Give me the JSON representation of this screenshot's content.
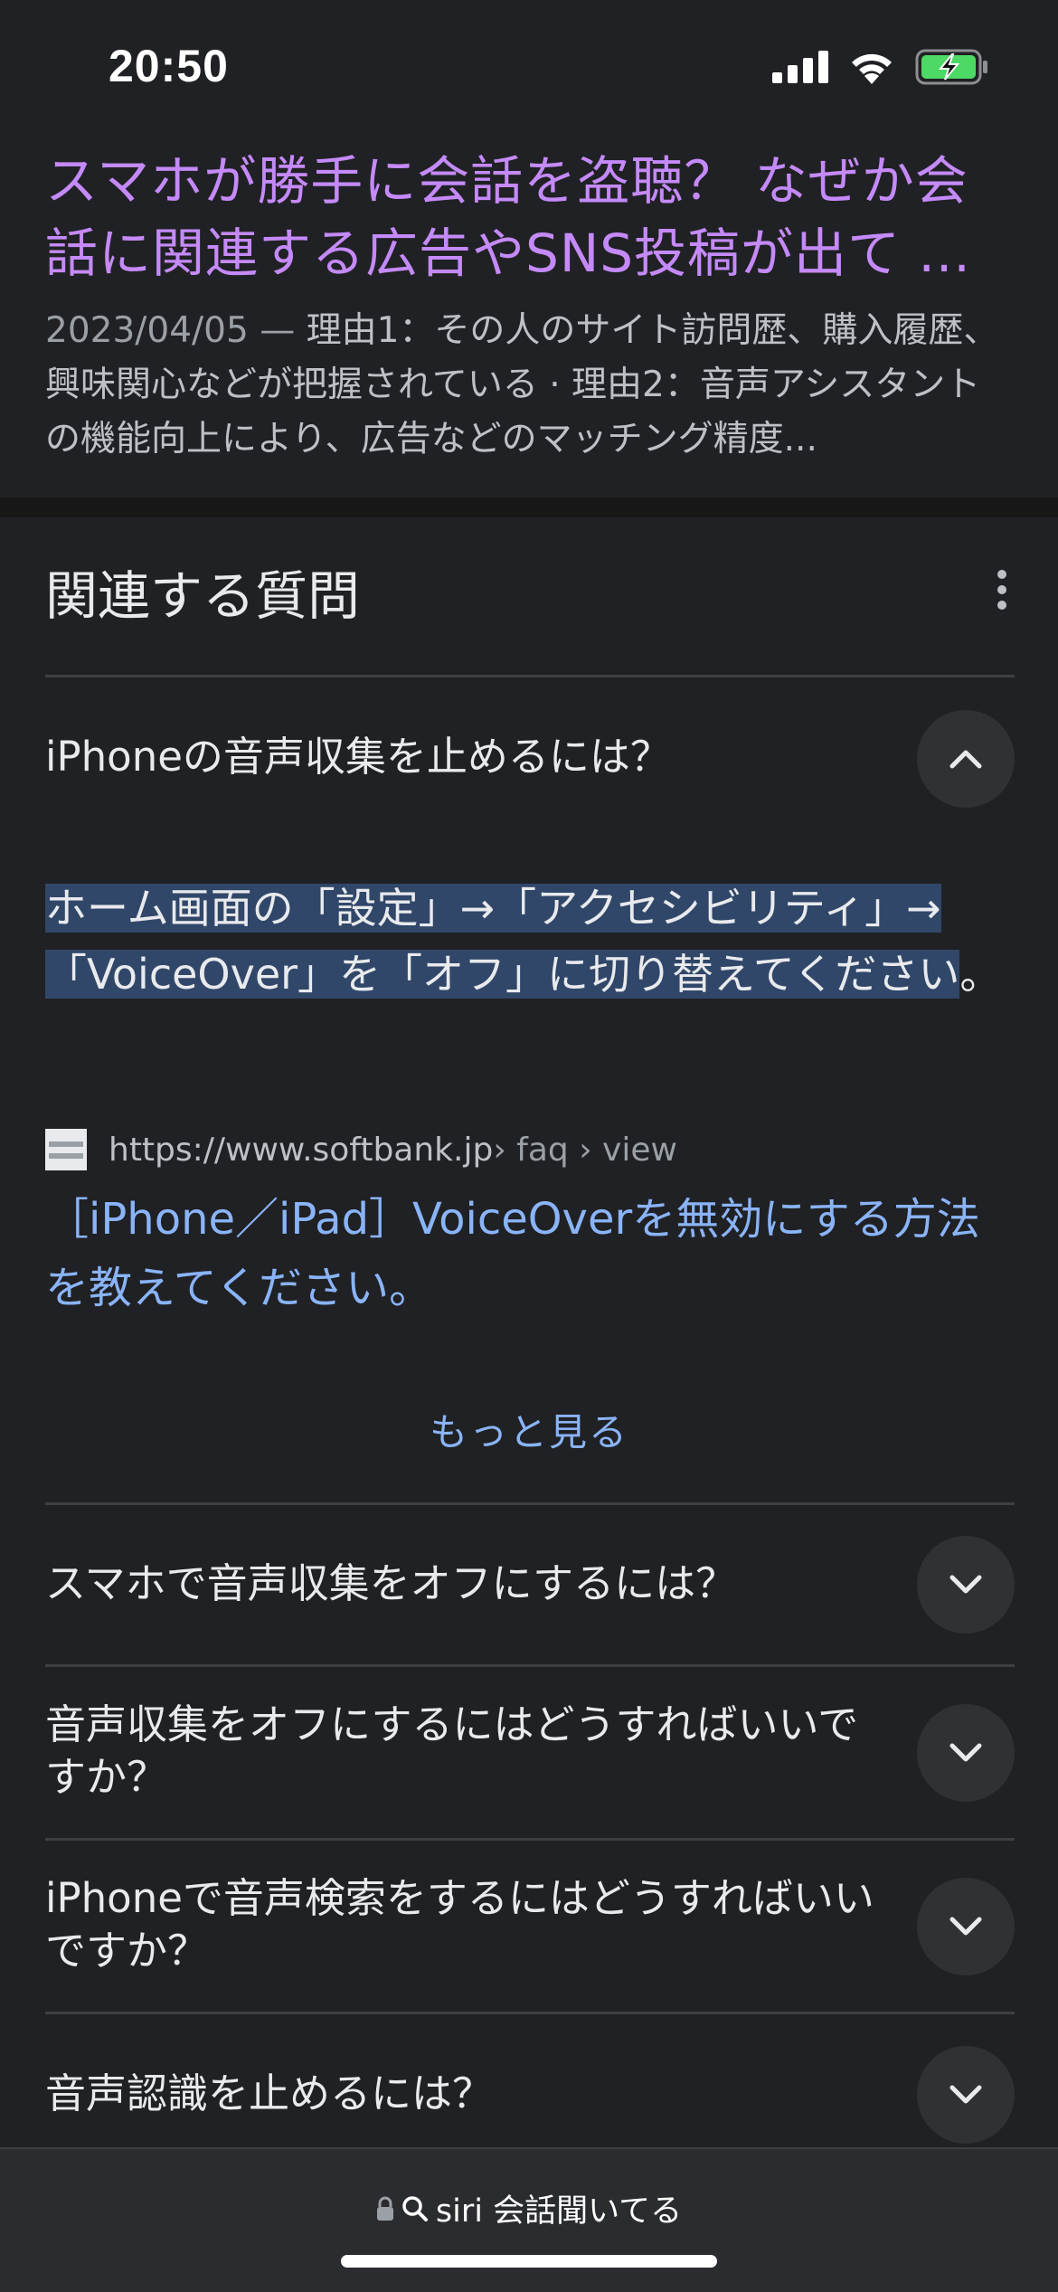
{
  "status_bar": {
    "time": "20:50",
    "icons": [
      "signal-icon",
      "wifi-icon",
      "battery-charging-icon"
    ]
  },
  "result": {
    "title": "スマホが勝手に会話を盗聴？ なぜか会話に関連する広告やSNS投稿が出て ...",
    "date": "2023/04/05",
    "separator": " — ",
    "snippet": "理由1：その人のサイト訪問歴、購入履歴、興味関心などが把握されている · 理由2：音声アシスタントの機能向上により、広告などのマッチング精度..."
  },
  "paa": {
    "heading": "関連する質問",
    "expanded": {
      "question": "iPhoneの音声収集を止めるには？",
      "answer_highlighted": "ホーム画面の「設定」→「アクセシビリティ」→「VoiceOver」を「オフ」に切り替えてください",
      "answer_tail": "。",
      "source": {
        "domain": "https://www.softbank.jp",
        "path": " › faq › view",
        "link_text": "［iPhone／iPad］VoiceOverを無効にする方法を教えてください。"
      },
      "see_more": "もっと見る"
    },
    "questions": [
      {
        "text": "スマホで音声収集をオフにするには？"
      },
      {
        "text": "音声収集をオフにするにはどうすればいいですか？"
      },
      {
        "text": "iPhoneで音声検索をするにはどうすればいいですか？"
      },
      {
        "text": "音声認識を止めるには？"
      }
    ]
  },
  "browser": {
    "address_text": "siri 会話聞いてる",
    "icons": [
      "lock-icon",
      "search-icon"
    ]
  },
  "colors": {
    "background": "#202124",
    "visited_link": "#c58af9",
    "link": "#8ab4f8",
    "highlight": "#314769",
    "battery": "#4cd964"
  }
}
